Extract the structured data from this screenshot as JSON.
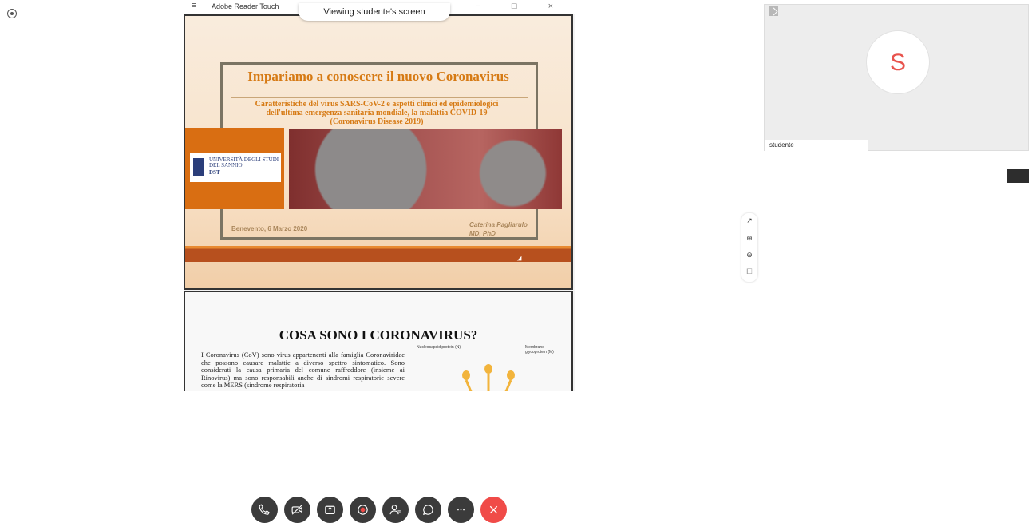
{
  "window": {
    "app_title": "Adobe Reader Touch",
    "viewing_banner": "Viewing studente's screen",
    "menu_glyph": "≡",
    "window_controls": "↘ − □ ×"
  },
  "slide1": {
    "title": "Impariamo a conoscere il nuovo Coronavirus",
    "subtitle_line1": "Caratteristiche del virus SARS-CoV-2 e aspetti clinici ed epidemiologici",
    "subtitle_line2": "dell'ultima emergenza sanitaria mondiale, la malattia COVID-19",
    "subtitle_line3": "(Coronavirus Disease 2019)",
    "logo_line1": "UNIVERSITÀ DEGLI STUDI",
    "logo_line2": "DEL SANNIO",
    "logo_line3": "DST",
    "place_date": "Benevento, 6 Marzo 2020",
    "author_line1": "Caterina Pagliarulo",
    "author_line2": "MD, PhD"
  },
  "slide2": {
    "title": "COSA SONO I CORONAVIRUS?",
    "body": "I Coronavirus (CoV) sono virus appartenenti alla famiglia Coronaviridae che possono causare malattie a diverso spettro sintomatico. Sono considerati la causa primaria del comune raffreddore (insieme ai Rinovirus) ma sono responsabili anche di sindromi respiratorie severe come la MERS (sindrome respiratoria",
    "label_nucleocapsid": "Nucleocapsid protein (N)",
    "label_membrane_1": "Membrane",
    "label_membrane_2": "glycoprotein (M)"
  },
  "participant": {
    "initial": "S",
    "name": "studente"
  },
  "icons": {
    "info": "info-icon",
    "zoom": [
      "expand-icon",
      "zoom-in-icon",
      "zoom-out-icon",
      "fit-icon"
    ],
    "controls": [
      "phone-icon",
      "video-off-icon",
      "share-icon",
      "record-icon",
      "participants-icon",
      "chat-icon",
      "more-icon",
      "end-call-icon"
    ]
  },
  "zoom_glyphs": {
    "expand": "↗",
    "zoom_in": "⊕",
    "zoom_out": "⊖",
    "fit": "⧠"
  },
  "colors": {
    "accent_orange": "#d67a14",
    "end_call_red": "#f04b48",
    "control_dark": "#3b3b3b",
    "avatar_red": "#e8534d"
  }
}
